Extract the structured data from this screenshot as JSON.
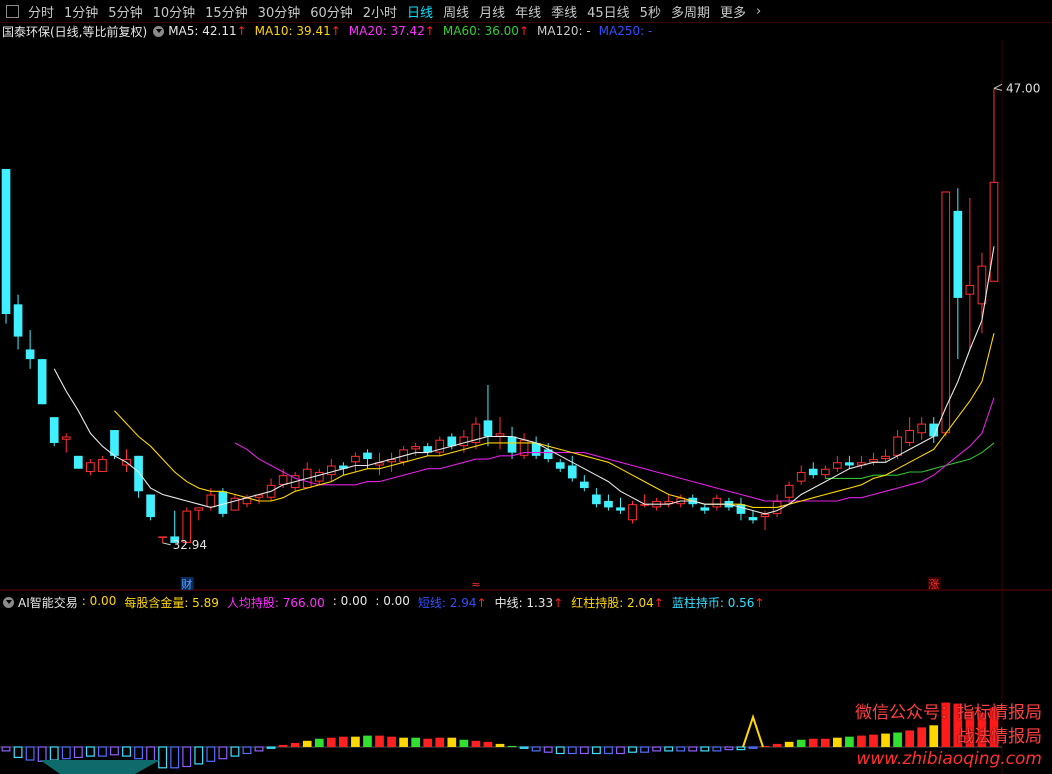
{
  "toolbar": {
    "items": [
      "分时",
      "1分钟",
      "5分钟",
      "10分钟",
      "15分钟",
      "30分钟",
      "60分钟",
      "2小时",
      "日线",
      "周线",
      "月线",
      "年线",
      "季线",
      "45日线",
      "5秒",
      "多周期",
      "更多"
    ],
    "active": "日线",
    "more_chevron": "›"
  },
  "main_info": {
    "title": "国泰环保(日线,等比前复权)",
    "ma": [
      {
        "label": "MA5: 42.11",
        "color": "#e8e8e8",
        "arrow": "↑"
      },
      {
        "label": "MA10: 39.41",
        "color": "#ffd700",
        "arrow": "↑"
      },
      {
        "label": "MA20: 37.42",
        "color": "#ff30ff",
        "arrow": "↑"
      },
      {
        "label": "MA60: 36.00",
        "color": "#30d030",
        "arrow": "↑"
      },
      {
        "label": "MA120: -",
        "color": "#c8c8c8",
        "arrow": ""
      },
      {
        "label": "MA250: -",
        "color": "#3050ff",
        "arrow": ""
      }
    ]
  },
  "sub_info": {
    "name": "AI智能交易",
    "items": [
      {
        "label": ": 0.00",
        "color": "#ffd700",
        "arrow": ""
      },
      {
        "label": "每股含金量: 5.89",
        "color": "#ffd700",
        "arrow": ""
      },
      {
        "label": "人均持股: 766.00",
        "color": "#ff30ff",
        "arrow": ""
      },
      {
        "label": ": 0.00",
        "color": "#e8e8e8",
        "arrow": ""
      },
      {
        "label": ": 0.00",
        "color": "#e8e8e8",
        "arrow": ""
      },
      {
        "label": "短线: 2.94",
        "color": "#3050ff",
        "arrow": "↑"
      },
      {
        "label": "中线: 1.33",
        "color": "#e8e8e8",
        "arrow": "↑"
      },
      {
        "label": "红柱持股: 2.04",
        "color": "#ffd700",
        "arrow": "↑"
      },
      {
        "label": "蓝柱持币: 0.56",
        "color": "#30e0ff",
        "arrow": "↑"
      }
    ]
  },
  "price_labels": {
    "high": "47.00",
    "low": "32.94"
  },
  "event_markers": [
    {
      "text": "财",
      "color": "#5aa0ff"
    },
    {
      "text": "≈",
      "color": "#ff3030"
    },
    {
      "text": "涨",
      "color": "#ff3030"
    }
  ],
  "watermark": {
    "line1": "微信公众号：指标情报局",
    "line2": "战法情报局",
    "url": "www.zhibiaoqing.com"
  },
  "colors": {
    "up": "#ff3030",
    "down": "#40f0ff",
    "ma5": "#e8e8e8",
    "ma10": "#ffd700",
    "ma20": "#e020e0",
    "ma60": "#30c030"
  },
  "chart_data": {
    "type": "candlestick",
    "ylim": [
      31.5,
      48.5
    ],
    "candles": [
      {
        "o": 44.5,
        "h": 44.5,
        "l": 39.7,
        "c": 40.0
      },
      {
        "o": 40.3,
        "h": 40.6,
        "l": 38.9,
        "c": 39.3
      },
      {
        "o": 38.9,
        "h": 39.5,
        "l": 38.3,
        "c": 38.6
      },
      {
        "o": 38.6,
        "h": 38.6,
        "l": 37.2,
        "c": 37.2
      },
      {
        "o": 36.8,
        "h": 36.8,
        "l": 35.9,
        "c": 36.0
      },
      {
        "o": 36.1,
        "h": 36.3,
        "l": 35.7,
        "c": 36.2
      },
      {
        "o": 35.6,
        "h": 35.6,
        "l": 35.2,
        "c": 35.2
      },
      {
        "o": 35.1,
        "h": 35.5,
        "l": 35.0,
        "c": 35.4
      },
      {
        "o": 35.1,
        "h": 35.6,
        "l": 35.1,
        "c": 35.5
      },
      {
        "o": 36.4,
        "h": 36.4,
        "l": 35.5,
        "c": 35.6
      },
      {
        "o": 35.3,
        "h": 35.8,
        "l": 35.1,
        "c": 35.5
      },
      {
        "o": 35.6,
        "h": 35.6,
        "l": 34.3,
        "c": 34.5
      },
      {
        "o": 34.4,
        "h": 34.4,
        "l": 33.6,
        "c": 33.7
      },
      {
        "o": 33.1,
        "h": 33.1,
        "l": 32.9,
        "c": 33.1
      },
      {
        "o": 33.1,
        "h": 33.9,
        "l": 32.9,
        "c": 32.9
      },
      {
        "o": 32.9,
        "h": 34.0,
        "l": 32.9,
        "c": 33.9
      },
      {
        "o": 33.9,
        "h": 34.0,
        "l": 33.6,
        "c": 34.0
      },
      {
        "o": 34.0,
        "h": 34.6,
        "l": 33.9,
        "c": 34.4
      },
      {
        "o": 34.5,
        "h": 34.6,
        "l": 33.7,
        "c": 33.8
      },
      {
        "o": 33.9,
        "h": 34.4,
        "l": 33.9,
        "c": 34.3
      },
      {
        "o": 34.1,
        "h": 34.4,
        "l": 34.0,
        "c": 34.3
      },
      {
        "o": 34.3,
        "h": 34.4,
        "l": 34.1,
        "c": 34.4
      },
      {
        "o": 34.3,
        "h": 34.9,
        "l": 34.2,
        "c": 34.7
      },
      {
        "o": 34.7,
        "h": 35.2,
        "l": 34.6,
        "c": 35.0
      },
      {
        "o": 34.6,
        "h": 35.1,
        "l": 34.5,
        "c": 35.0
      },
      {
        "o": 34.6,
        "h": 35.4,
        "l": 34.6,
        "c": 35.2
      },
      {
        "o": 34.8,
        "h": 35.2,
        "l": 34.7,
        "c": 35.1
      },
      {
        "o": 35.0,
        "h": 35.5,
        "l": 34.8,
        "c": 35.3
      },
      {
        "o": 35.3,
        "h": 35.4,
        "l": 35.0,
        "c": 35.2
      },
      {
        "o": 35.4,
        "h": 35.7,
        "l": 35.1,
        "c": 35.6
      },
      {
        "o": 35.7,
        "h": 35.8,
        "l": 35.2,
        "c": 35.5
      },
      {
        "o": 35.3,
        "h": 35.7,
        "l": 35.0,
        "c": 35.4
      },
      {
        "o": 35.4,
        "h": 35.7,
        "l": 35.1,
        "c": 35.5
      },
      {
        "o": 35.4,
        "h": 35.9,
        "l": 35.3,
        "c": 35.8
      },
      {
        "o": 35.8,
        "h": 36.0,
        "l": 35.6,
        "c": 35.9
      },
      {
        "o": 35.9,
        "h": 36.0,
        "l": 35.6,
        "c": 35.7
      },
      {
        "o": 35.7,
        "h": 36.2,
        "l": 35.6,
        "c": 36.1
      },
      {
        "o": 36.2,
        "h": 36.3,
        "l": 35.8,
        "c": 35.9
      },
      {
        "o": 35.9,
        "h": 36.4,
        "l": 35.7,
        "c": 36.2
      },
      {
        "o": 36.0,
        "h": 36.8,
        "l": 35.8,
        "c": 36.6
      },
      {
        "o": 36.7,
        "h": 37.8,
        "l": 35.9,
        "c": 36.2
      },
      {
        "o": 36.2,
        "h": 36.8,
        "l": 35.8,
        "c": 36.3
      },
      {
        "o": 36.2,
        "h": 36.5,
        "l": 35.5,
        "c": 35.7
      },
      {
        "o": 35.6,
        "h": 36.3,
        "l": 35.5,
        "c": 36.1
      },
      {
        "o": 36.0,
        "h": 36.2,
        "l": 35.5,
        "c": 35.6
      },
      {
        "o": 35.8,
        "h": 36.0,
        "l": 35.4,
        "c": 35.5
      },
      {
        "o": 35.4,
        "h": 35.5,
        "l": 35.1,
        "c": 35.2
      },
      {
        "o": 35.3,
        "h": 35.6,
        "l": 34.8,
        "c": 34.9
      },
      {
        "o": 34.8,
        "h": 35.0,
        "l": 34.5,
        "c": 34.6
      },
      {
        "o": 34.4,
        "h": 34.6,
        "l": 34.0,
        "c": 34.1
      },
      {
        "o": 34.2,
        "h": 34.4,
        "l": 33.9,
        "c": 34.0
      },
      {
        "o": 34.0,
        "h": 34.3,
        "l": 33.8,
        "c": 33.9
      },
      {
        "o": 33.6,
        "h": 34.2,
        "l": 33.5,
        "c": 34.1
      },
      {
        "o": 34.1,
        "h": 34.4,
        "l": 34.0,
        "c": 34.1
      },
      {
        "o": 34.0,
        "h": 34.3,
        "l": 33.9,
        "c": 34.2
      },
      {
        "o": 34.1,
        "h": 34.4,
        "l": 34.0,
        "c": 34.2
      },
      {
        "o": 34.1,
        "h": 34.4,
        "l": 34.0,
        "c": 34.3
      },
      {
        "o": 34.3,
        "h": 34.4,
        "l": 34.0,
        "c": 34.1
      },
      {
        "o": 34.0,
        "h": 34.1,
        "l": 33.8,
        "c": 33.9
      },
      {
        "o": 34.0,
        "h": 34.4,
        "l": 33.9,
        "c": 34.3
      },
      {
        "o": 34.2,
        "h": 34.3,
        "l": 33.9,
        "c": 34.0
      },
      {
        "o": 34.1,
        "h": 34.3,
        "l": 33.6,
        "c": 33.8
      },
      {
        "o": 33.7,
        "h": 33.9,
        "l": 33.5,
        "c": 33.6
      },
      {
        "o": 33.7,
        "h": 33.9,
        "l": 33.3,
        "c": 33.8
      },
      {
        "o": 33.8,
        "h": 34.4,
        "l": 33.7,
        "c": 34.2
      },
      {
        "o": 34.3,
        "h": 34.8,
        "l": 34.1,
        "c": 34.7
      },
      {
        "o": 34.8,
        "h": 35.3,
        "l": 34.7,
        "c": 35.1
      },
      {
        "o": 35.2,
        "h": 35.4,
        "l": 34.9,
        "c": 35.0
      },
      {
        "o": 35.0,
        "h": 35.3,
        "l": 34.9,
        "c": 35.2
      },
      {
        "o": 35.2,
        "h": 35.6,
        "l": 35.1,
        "c": 35.4
      },
      {
        "o": 35.4,
        "h": 35.6,
        "l": 35.2,
        "c": 35.3
      },
      {
        "o": 35.3,
        "h": 35.6,
        "l": 35.2,
        "c": 35.4
      },
      {
        "o": 35.4,
        "h": 35.7,
        "l": 35.3,
        "c": 35.5
      },
      {
        "o": 35.5,
        "h": 35.8,
        "l": 35.4,
        "c": 35.6
      },
      {
        "o": 35.6,
        "h": 36.4,
        "l": 35.5,
        "c": 36.2
      },
      {
        "o": 36.0,
        "h": 36.8,
        "l": 35.9,
        "c": 36.4
      },
      {
        "o": 36.3,
        "h": 36.8,
        "l": 36.1,
        "c": 36.6
      },
      {
        "o": 36.6,
        "h": 36.8,
        "l": 36.0,
        "c": 36.2
      },
      {
        "o": 36.3,
        "h": 43.8,
        "l": 36.2,
        "c": 43.8
      },
      {
        "o": 43.2,
        "h": 43.9,
        "l": 38.6,
        "c": 40.5
      },
      {
        "o": 40.6,
        "h": 43.6,
        "l": 38.9,
        "c": 40.9
      },
      {
        "o": 40.3,
        "h": 41.9,
        "l": 39.4,
        "c": 41.5
      },
      {
        "o": 41.0,
        "h": 47.0,
        "l": 41.0,
        "c": 44.1
      }
    ],
    "ma5": [
      null,
      null,
      null,
      null,
      38.3,
      37.6,
      37.0,
      36.3,
      35.9,
      35.6,
      35.4,
      35.1,
      34.6,
      34.4,
      34.3,
      34.2,
      34.1,
      34.0,
      34.1,
      34.2,
      34.3,
      34.4,
      34.5,
      34.7,
      34.8,
      34.9,
      35.0,
      35.1,
      35.2,
      35.3,
      35.3,
      35.4,
      35.5,
      35.6,
      35.7,
      35.7,
      35.8,
      35.9,
      36.0,
      36.1,
      36.2,
      36.2,
      36.2,
      36.1,
      36.0,
      35.8,
      35.6,
      35.4,
      35.2,
      35.0,
      34.8,
      34.5,
      34.3,
      34.1,
      34.1,
      34.1,
      34.2,
      34.2,
      34.1,
      34.1,
      34.1,
      34.0,
      33.9,
      33.8,
      33.9,
      34.1,
      34.4,
      34.6,
      34.8,
      35.0,
      35.2,
      35.3,
      35.4,
      35.4,
      35.6,
      35.8,
      36.0,
      36.2,
      37.1,
      37.9,
      38.9,
      39.8,
      42.1
    ],
    "ma10": [
      null,
      null,
      null,
      null,
      null,
      null,
      null,
      null,
      null,
      37.0,
      36.6,
      36.2,
      35.9,
      35.5,
      35.1,
      34.8,
      34.6,
      34.5,
      34.5,
      34.4,
      34.3,
      34.2,
      34.2,
      34.3,
      34.5,
      34.6,
      34.7,
      34.8,
      35.0,
      35.1,
      35.2,
      35.2,
      35.3,
      35.4,
      35.5,
      35.6,
      35.6,
      35.7,
      35.8,
      35.9,
      36.0,
      36.0,
      36.0,
      36.0,
      36.0,
      35.9,
      35.8,
      35.7,
      35.6,
      35.5,
      35.4,
      35.2,
      35.0,
      34.8,
      34.6,
      34.4,
      34.3,
      34.2,
      34.1,
      34.1,
      34.1,
      34.1,
      34.0,
      34.0,
      34.0,
      34.1,
      34.2,
      34.3,
      34.4,
      34.5,
      34.6,
      34.7,
      34.9,
      35.0,
      35.2,
      35.4,
      35.6,
      35.8,
      36.3,
      36.8,
      37.3,
      37.9,
      39.4
    ],
    "ma20": [
      null,
      null,
      null,
      null,
      null,
      null,
      null,
      null,
      null,
      null,
      null,
      null,
      null,
      null,
      null,
      null,
      null,
      null,
      null,
      36.0,
      35.8,
      35.5,
      35.3,
      35.1,
      34.9,
      34.8,
      34.7,
      34.7,
      34.7,
      34.7,
      34.8,
      34.8,
      34.9,
      35.0,
      35.1,
      35.2,
      35.2,
      35.3,
      35.4,
      35.5,
      35.5,
      35.6,
      35.6,
      35.7,
      35.7,
      35.7,
      35.7,
      35.7,
      35.7,
      35.6,
      35.5,
      35.4,
      35.3,
      35.2,
      35.1,
      35.0,
      34.9,
      34.8,
      34.7,
      34.6,
      34.5,
      34.4,
      34.3,
      34.2,
      34.2,
      34.2,
      34.2,
      34.2,
      34.2,
      34.2,
      34.3,
      34.3,
      34.4,
      34.5,
      34.6,
      34.7,
      34.8,
      35.0,
      35.3,
      35.6,
      35.9,
      36.3,
      37.4
    ],
    "ma60": [
      null,
      null,
      null,
      null,
      null,
      null,
      null,
      null,
      null,
      null,
      null,
      null,
      null,
      null,
      null,
      null,
      null,
      null,
      null,
      null,
      null,
      null,
      null,
      null,
      null,
      null,
      null,
      null,
      null,
      null,
      null,
      null,
      null,
      null,
      null,
      null,
      null,
      null,
      null,
      null,
      null,
      null,
      null,
      null,
      null,
      null,
      null,
      null,
      null,
      null,
      null,
      null,
      null,
      null,
      null,
      null,
      null,
      null,
      null,
      null,
      null,
      null,
      null,
      null,
      null,
      null,
      null,
      null,
      34.9,
      34.9,
      34.9,
      34.9,
      35.0,
      35.0,
      35.0,
      35.1,
      35.1,
      35.2,
      35.3,
      35.4,
      35.5,
      35.7,
      36.0
    ],
    "indicator": {
      "bars": [
        -0.3,
        -0.8,
        -1.0,
        -1.1,
        -1.0,
        -0.9,
        -0.8,
        -0.7,
        -0.7,
        -0.6,
        -0.7,
        -0.9,
        -1.2,
        -1.6,
        -1.6,
        -1.5,
        -1.3,
        -1.1,
        -0.9,
        -0.7,
        -0.5,
        -0.3,
        -0.1,
        0.2,
        0.4,
        0.6,
        0.8,
        0.9,
        1.0,
        1.0,
        1.1,
        1.1,
        1.0,
        0.9,
        0.9,
        0.8,
        0.9,
        0.9,
        0.7,
        0.6,
        0.5,
        0.3,
        0.1,
        -0.1,
        -0.3,
        -0.4,
        -0.5,
        -0.5,
        -0.5,
        -0.5,
        -0.5,
        -0.5,
        -0.4,
        -0.4,
        -0.3,
        -0.3,
        -0.3,
        -0.3,
        -0.3,
        -0.3,
        -0.2,
        -0.2,
        -0.1,
        0.1,
        0.3,
        0.5,
        0.7,
        0.8,
        0.8,
        0.9,
        1.0,
        1.1,
        1.2,
        1.3,
        1.4,
        1.6,
        1.9,
        2.1,
        4.3,
        4.2,
        3.5,
        3.3,
        3.8
      ],
      "ylim": [
        -2,
        6
      ]
    }
  }
}
